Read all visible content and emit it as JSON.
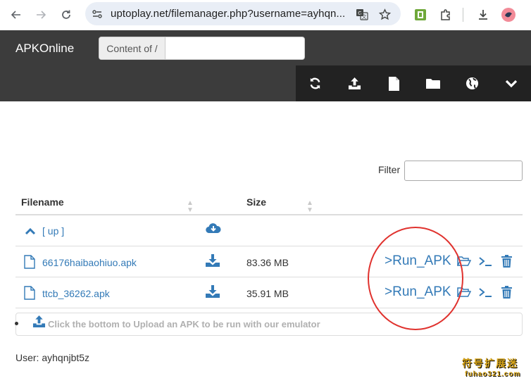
{
  "browser": {
    "url": "uptoplay.net/filemanager.php?username=ayhqn..."
  },
  "header": {
    "brand": "APKOnline",
    "content_of_label": "Content of /",
    "content_of_value": ""
  },
  "toolbar": {
    "buttons": [
      "refresh-icon",
      "upload-icon",
      "new-file-icon",
      "new-folder-icon",
      "globe-icon",
      "chevron-down-icon"
    ]
  },
  "filter": {
    "label": "Filter",
    "value": ""
  },
  "table": {
    "headers": {
      "filename": "Filename",
      "size": "Size"
    },
    "up_label": "[ up ]",
    "rows": [
      {
        "name": "66176haibaohiuo.apk",
        "size": "83.36 MB",
        "action": ">Run_APK"
      },
      {
        "name": "ttcb_36262.apk",
        "size": "35.91 MB",
        "action": ">Run_APK"
      }
    ]
  },
  "upload": {
    "text": "Click the bottom to Upload an APK to be run with our emulator"
  },
  "user": {
    "line": "User: ayhqnjbt5z"
  },
  "watermark": {
    "top": "符号扩展迷",
    "bottom": "fuhao321.com"
  },
  "colors": {
    "header_bg": "#3c3c3c",
    "toolbar_bg": "#222222",
    "link": "#337ab7",
    "annotation": "#e0322e"
  }
}
